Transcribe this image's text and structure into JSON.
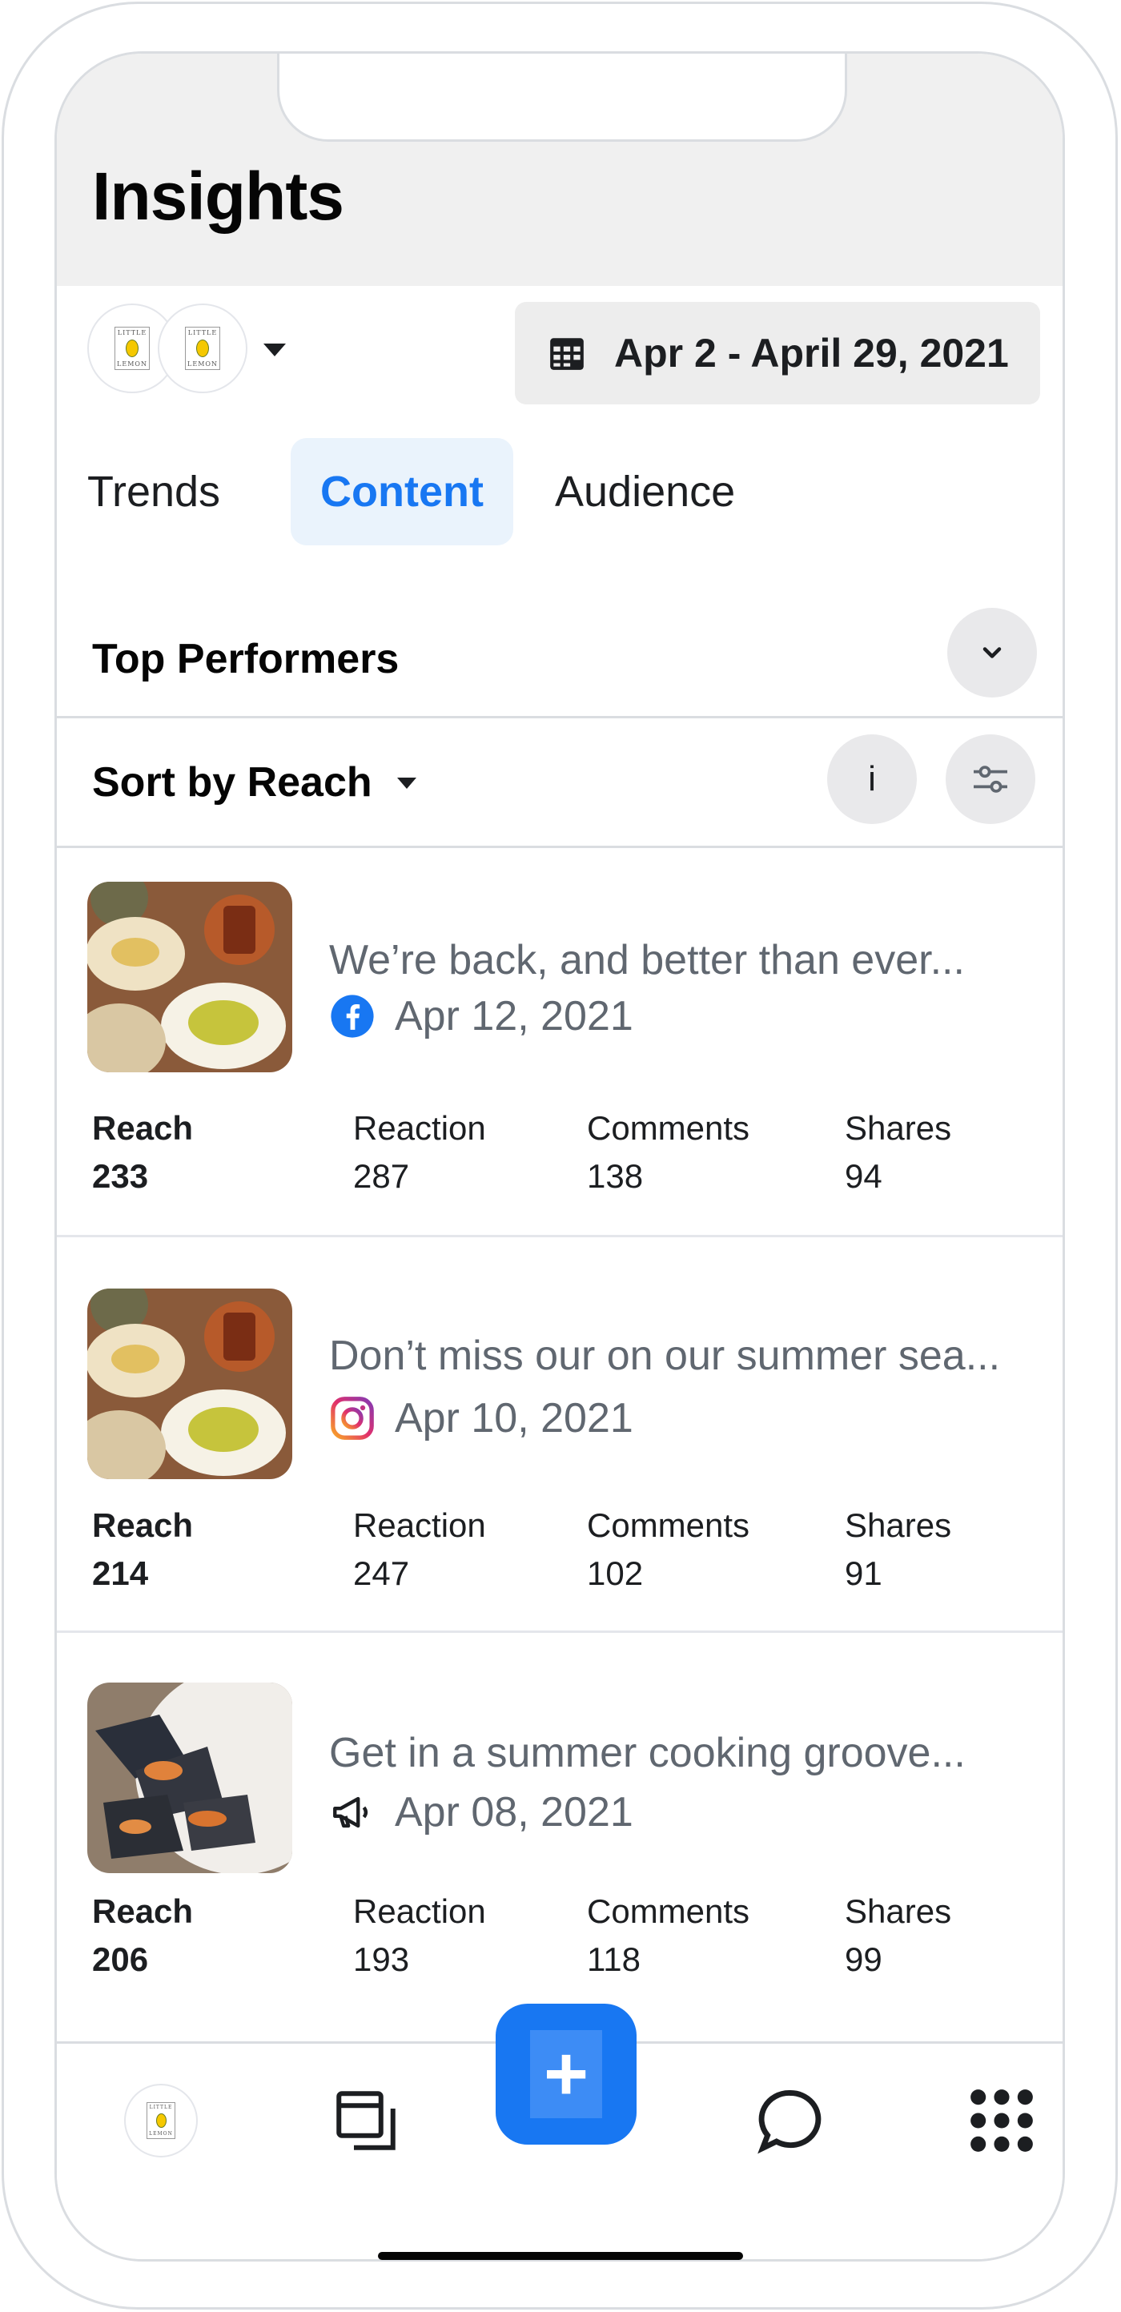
{
  "header": {
    "title": "Insights"
  },
  "account_switcher": {
    "logo_text_top": "LITTLE",
    "logo_text_bottom": "LEMON"
  },
  "date_range": {
    "label": "Apr 2 - April 29, 2021"
  },
  "tabs": [
    {
      "label": "Trends",
      "active": false
    },
    {
      "label": "Content",
      "active": true
    },
    {
      "label": "Audience",
      "active": false
    }
  ],
  "section": {
    "title": "Top Performers"
  },
  "sort": {
    "label": "Sort by Reach",
    "info_label": "i"
  },
  "posts": [
    {
      "text": "We’re back, and better than ever...",
      "platform": "facebook-icon",
      "date": "Apr 12, 2021",
      "stats": {
        "reach_label": "Reach",
        "reach": "233",
        "reaction_label": "Reaction",
        "reaction": "287",
        "comments_label": "Comments",
        "comments": "138",
        "shares_label": "Shares",
        "shares": "94"
      }
    },
    {
      "text": "Don’t miss our on our summer sea...",
      "platform": "instagram-icon",
      "date": "Apr 10, 2021",
      "stats": {
        "reach_label": "Reach",
        "reach": "214",
        "reaction_label": "Reaction",
        "reaction": "247",
        "comments_label": "Comments",
        "comments": "102",
        "shares_label": "Shares",
        "shares": "91"
      }
    },
    {
      "text": "Get in a summer cooking groove...",
      "platform": "megaphone-icon",
      "date": "Apr 08, 2021",
      "stats": {
        "reach_label": "Reach",
        "reach": "206",
        "reaction_label": "Reaction",
        "reaction": "193",
        "comments_label": "Comments",
        "comments": "118",
        "shares_label": "Shares",
        "shares": "99"
      }
    }
  ],
  "bottom_nav": {
    "create_label": "+"
  },
  "colors": {
    "accent": "#1877f2",
    "header_bg": "#f0f0f0",
    "active_tab_bg": "#eaf3fc"
  }
}
